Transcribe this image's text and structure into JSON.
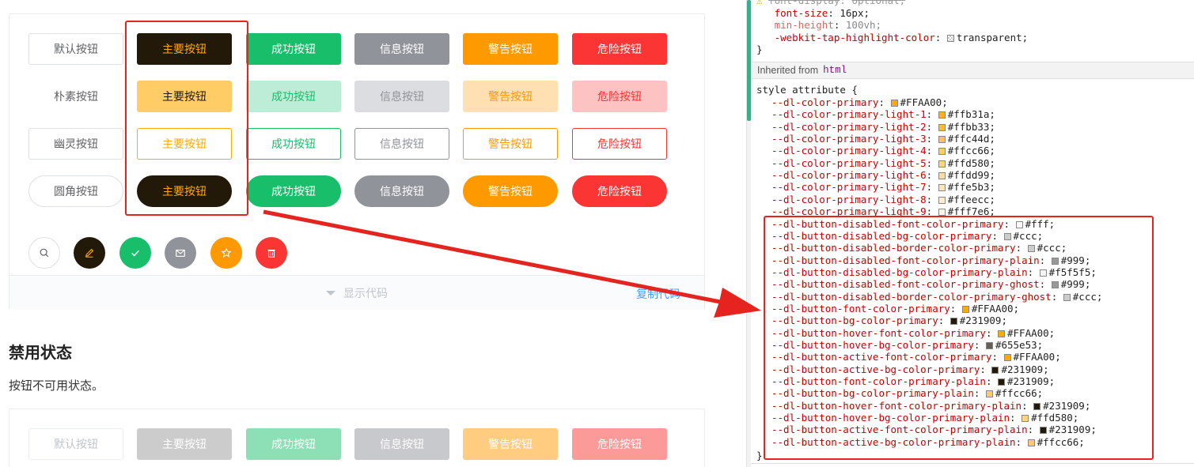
{
  "demo": {
    "row_labels": [
      "默认按钮",
      "主要按钮",
      "成功按钮",
      "信息按钮",
      "警告按钮",
      "危险按钮"
    ],
    "plain_first": "朴素按钮",
    "ghost_first": "幽灵按钮",
    "round_first": "圆角按钮",
    "show_code": "显示代码",
    "copy_code": "复制代码",
    "icons": [
      "search-icon",
      "edit-icon",
      "check-icon",
      "mail-icon",
      "star-icon",
      "delete-icon"
    ]
  },
  "disabled_section": {
    "title": "禁用状态",
    "desc": "按钮不可用状态。",
    "labels": [
      "默认按钮",
      "主要按钮",
      "成功按钮",
      "信息按钮",
      "警告按钮",
      "危险按钮"
    ]
  },
  "colors": {
    "primary_bg": "#231909",
    "primary_font": "#FFAA00",
    "success": "#19be6b",
    "info": "#909399",
    "warning": "#ff9900",
    "danger": "#fa3534",
    "annotation": "#e52420"
  },
  "devtools": {
    "top_lines": [
      {
        "name": "font-display",
        "value": "optional;",
        "strike": true,
        "warn": true
      },
      {
        "name": "font-size",
        "value": "16px;"
      },
      {
        "name": "min-height",
        "value": "100vh;",
        "dim": true
      },
      {
        "name": "-webkit-tap-highlight-color",
        "value": "transparent;",
        "swatch": "transparent"
      }
    ],
    "close_brace": "}",
    "inherited_from": "Inherited from",
    "inherited_tag": "html",
    "style_attr": "style attribute {",
    "vars": [
      {
        "name": "--dl-color-primary",
        "value": "#FFAA00;",
        "swatch": "#FFAA00"
      },
      {
        "name": "--dl-color-primary-light-1",
        "value": "#ffb31a;",
        "swatch": "#ffb31a"
      },
      {
        "name": "--dl-color-primary-light-2",
        "value": "#ffbb33;",
        "swatch": "#ffbb33"
      },
      {
        "name": "--dl-color-primary-light-3",
        "value": "#ffc44d;",
        "swatch": "#ffc44d"
      },
      {
        "name": "--dl-color-primary-light-4",
        "value": "#ffcc66;",
        "swatch": "#ffcc66"
      },
      {
        "name": "--dl-color-primary-light-5",
        "value": "#ffd580;",
        "swatch": "#ffd580"
      },
      {
        "name": "--dl-color-primary-light-6",
        "value": "#ffdd99;",
        "swatch": "#ffdd99"
      },
      {
        "name": "--dl-color-primary-light-7",
        "value": "#ffe5b3;",
        "swatch": "#ffe5b3"
      },
      {
        "name": "--dl-color-primary-light-8",
        "value": "#ffeecc;",
        "swatch": "#ffeecc"
      },
      {
        "name": "--dl-color-primary-light-9",
        "value": "#fff7e6;",
        "swatch": "#fff7e6"
      },
      {
        "name": "--dl-button-disabled-font-color-primary",
        "value": "#fff;",
        "swatch": "#ffffff"
      },
      {
        "name": "--dl-button-disabled-bg-color-primary",
        "value": "#ccc;",
        "swatch": "#cccccc"
      },
      {
        "name": "--dl-button-disabled-border-color-primary",
        "value": "#ccc;",
        "swatch": "#cccccc"
      },
      {
        "name": "--dl-button-disabled-font-color-primary-plain",
        "value": "#999;",
        "swatch": "#999999"
      },
      {
        "name": "--dl-button-disabled-bg-color-primary-plain",
        "value": "#f5f5f5;",
        "swatch": "#f5f5f5"
      },
      {
        "name": "--dl-button-disabled-font-color-primary-ghost",
        "value": "#999;",
        "swatch": "#999999"
      },
      {
        "name": "--dl-button-disabled-border-color-primary-ghost",
        "value": "#ccc;",
        "swatch": "#cccccc"
      },
      {
        "name": "--dl-button-font-color-primary",
        "value": "#FFAA00;",
        "swatch": "#FFAA00"
      },
      {
        "name": "--dl-button-bg-color-primary",
        "value": "#231909;",
        "swatch": "#231909"
      },
      {
        "name": "--dl-button-hover-font-color-primary",
        "value": "#FFAA00;",
        "swatch": "#FFAA00"
      },
      {
        "name": "--dl-button-hover-bg-color-primary",
        "value": "#655e53;",
        "swatch": "#655e53"
      },
      {
        "name": "--dl-button-active-font-color-primary",
        "value": "#FFAA00;",
        "swatch": "#FFAA00"
      },
      {
        "name": "--dl-button-active-bg-color-primary",
        "value": "#231909;",
        "swatch": "#231909"
      },
      {
        "name": "--dl-button-font-color-primary-plain",
        "value": "#231909;",
        "swatch": "#231909"
      },
      {
        "name": "--dl-button-bg-color-primary-plain",
        "value": "#ffcc66;",
        "swatch": "#ffcc66"
      },
      {
        "name": "--dl-button-hover-font-color-primary-plain",
        "value": "#231909;",
        "swatch": "#231909"
      },
      {
        "name": "--dl-button-hover-bg-color-primary-plain",
        "value": "#ffd580;",
        "swatch": "#ffd580"
      },
      {
        "name": "--dl-button-active-font-color-primary-plain",
        "value": "#231909;",
        "swatch": "#231909"
      },
      {
        "name": "--dl-button-active-bg-color-primary-plain",
        "value": "#ffcc66;",
        "swatch": "#ffcc66"
      }
    ],
    "end_brace": "}"
  }
}
